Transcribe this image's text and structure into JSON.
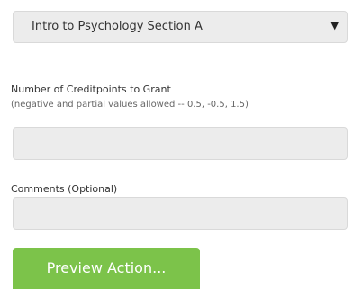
{
  "course_select": {
    "value": "Intro to Psychology Section A",
    "arrow_icon": "triangle-down-icon"
  },
  "credits": {
    "label": "Number of Creditpoints to Grant",
    "hint": "(negative and partial values allowed -- 0.5, -0.5, 1.5)",
    "value": "",
    "placeholder": ""
  },
  "comments": {
    "label": "Comments (Optional)",
    "value": "",
    "placeholder": ""
  },
  "preview_button": {
    "label": "Preview Action...",
    "color": "#7cc34a"
  }
}
